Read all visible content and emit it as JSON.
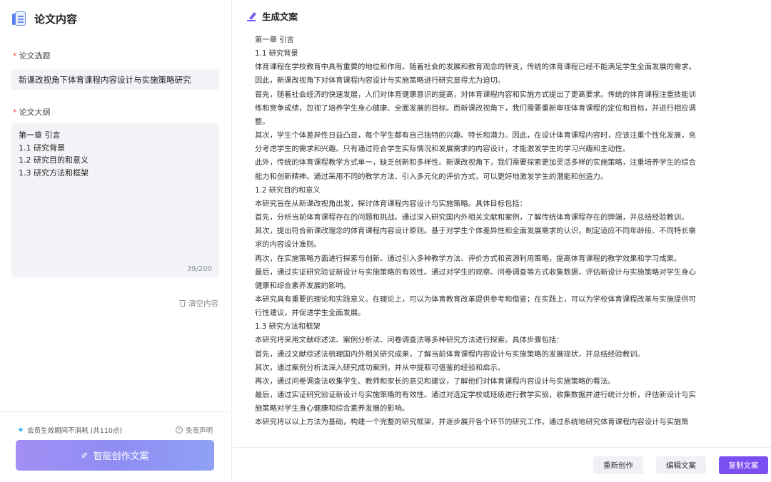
{
  "left_panel": {
    "title": "论文内容",
    "topic_label": "论文选题",
    "topic_value": "新课改视角下体育课程内容设计与实施策略研究",
    "outline_label": "论文大纲",
    "outline_lines": [
      "第一章 引言",
      "1.1 研究背景",
      "1.2 研究目的和意义",
      "1.3 研究方法和框架"
    ],
    "char_counter": "39/200",
    "clear_label": "清空内容",
    "credit_note": "会员生效期间不消耗 (共110点)",
    "disclaimer_label": "免责声明",
    "create_button_label": "智能创作文案"
  },
  "right_panel": {
    "title": "生成文案",
    "content_lines": [
      "第一章 引言",
      "1.1 研究背景",
      "体育课程在学校教育中具有重要的地位和作用。随着社会的发展和教育观念的转变，传统的体育课程已经不能满足学生全面发展的需求。",
      "因此，新课改视角下对体育课程内容设计与实施策略进行研究显得尤为迫切。",
      "首先，随着社会经济的快速发展，人们对体育健康意识的提高，对体育课程内容和实施方式提出了更高要求。传统的体育课程注重技能训",
      "练和竞争成绩，忽视了培养学生身心健康、全面发展的目标。而新课改视角下，我们需要重新审视体育课程的定位和目标，并进行相应调",
      "整。",
      "其次，学生个体差异性日益凸显，每个学生都有自己独特的兴趣、特长和潜力。因此，在设计体育课程内容时，应该注重个性化发展，充",
      "分考虑学生的需求和兴趣。只有通过符合学生实际情况和发展需求的内容设计，才能激发学生的学习兴趣和主动性。",
      "此外，传统的体育课程教学方式单一，缺乏创新和多样性。新课改视角下，我们需要探索更加灵活多样的实施策略，注重培养学生的综合",
      "能力和创新精神。通过采用不同的教学方法、引入多元化的评价方式，可以更好地激发学生的潜能和创造力。",
      "1.2 研究目的和意义",
      "本研究旨在从新课改视角出发，探讨体育课程内容设计与实施策略。具体目标包括：",
      "首先，分析当前体育课程存在的问题和挑战。通过深入研究国内外相关文献和案例，了解传统体育课程存在的弊端，并总结经验教训。",
      "其次，提出符合新课改理念的体育课程内容设计原则。基于对学生个体差异性和全面发展需求的认识，制定适应不同年龄段、不同特长需",
      "求的内容设计准则。",
      "再次，在实施策略方面进行探索与创新。通过引入多种教学方法、评价方式和资源利用策略，提高体育课程的教学效果和学习成果。",
      "最后，通过实证研究验证新设计与实施策略的有效性。通过对学生的观察、问卷调查等方式收集数据，评估新设计与实施策略对学生身心",
      "健康和综合素养发展的影响。",
      "本研究具有重要的理论和实践意义。在理论上，可以为体育教育改革提供参考和借鉴；在实践上，可以为学校体育课程改革与实施提供可",
      "行性建议，并促进学生全面发展。",
      "1.3 研究方法和框架",
      "本研究将采用文献综述法、案例分析法、问卷调查法等多种研究方法进行探索。具体步骤包括：",
      "首先，通过文献综述法梳理国内外相关研究成果，了解当前体育课程内容设计与实施策略的发展现状，并总结经验教训。",
      "其次，通过案例分析法深入研究成功案例，并从中提取可借鉴的经验和启示。",
      "再次，通过问卷调查法收集学生、教师和家长的意见和建议，了解他们对体育课程内容设计与实施策略的看法。",
      "最后，通过实证研究验证新设计与实施策略的有效性。通过对选定学校或班级进行教学实验，收集数据并进行统计分析，评估新设计与实",
      "施策略对学生身心健康和综合素养发展的影响。",
      "本研究将以以上方法为基础，构建一个完整的研究框架，并逐步展开各个环节的研究工作。通过系统地研究体育课程内容设计与实施策"
    ],
    "buttons": {
      "recreate": "重新创作",
      "edit": "编辑文案",
      "copy": "复制文案"
    }
  },
  "colors": {
    "accent_purple": "#7c4ff3",
    "required_red": "#e5484d",
    "input_bg": "#f3f4f7"
  }
}
